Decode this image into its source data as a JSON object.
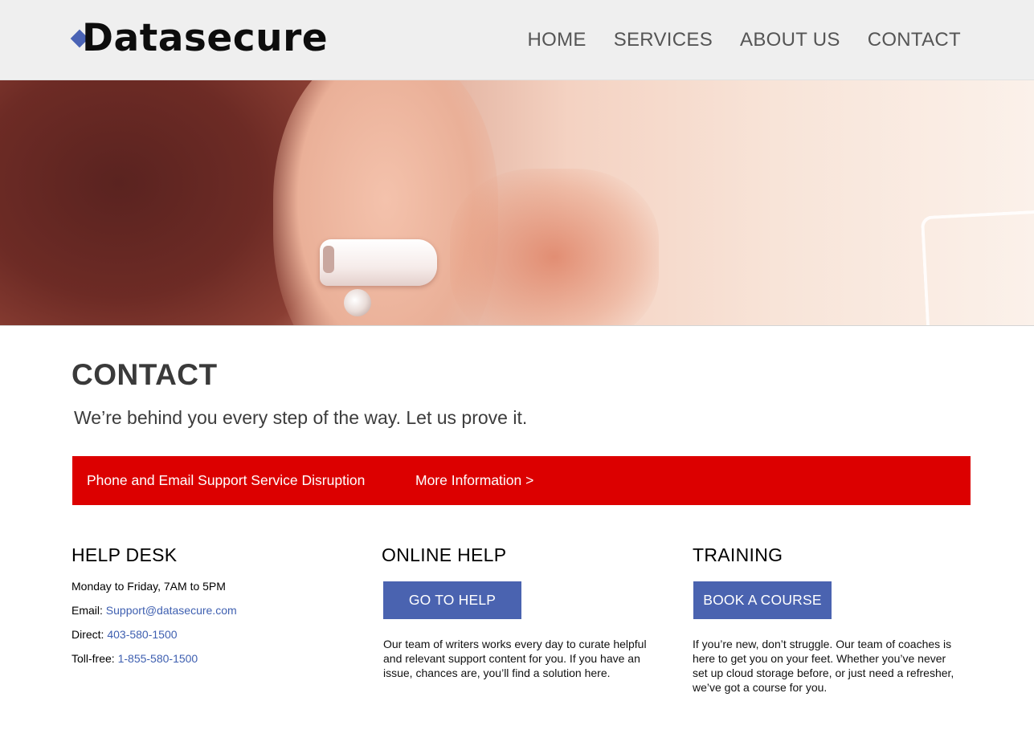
{
  "brand": {
    "name": "Datasecure",
    "accent": "#4a63b5"
  },
  "nav": {
    "items": [
      "HOME",
      "SERVICES",
      "ABOUT US",
      "CONTACT"
    ]
  },
  "page": {
    "title": "CONTACT",
    "tagline": "We’re behind you every step of the way. Let us prove it."
  },
  "alert": {
    "text": "Phone and Email Support Service Disruption",
    "link": "More Information >",
    "color": "#dc0000"
  },
  "help_desk": {
    "heading": "HELP DESK",
    "hours": "Monday to Friday, 7AM to 5PM",
    "email_label": "Email:",
    "email": "Support@datasecure.com",
    "direct_label": "Direct:",
    "direct": "403-580-1500",
    "tollfree_label": "Toll-free:",
    "tollfree": "1-855-580-1500"
  },
  "online_help": {
    "heading": "ONLINE HELP",
    "button": "GO TO HELP",
    "description": "Our team of writers works every day to curate helpful and relevant support content for you. If you have an issue, chances are, you’ll find a solution here."
  },
  "training": {
    "heading": "TRAINING",
    "button": "BOOK A COURSE",
    "description": "If you’re new, don’t struggle. Our team of coaches is here to get you on your feet. Whether you’ve never set up cloud storage before, or just need a refresher, we’ve got a course for you."
  }
}
